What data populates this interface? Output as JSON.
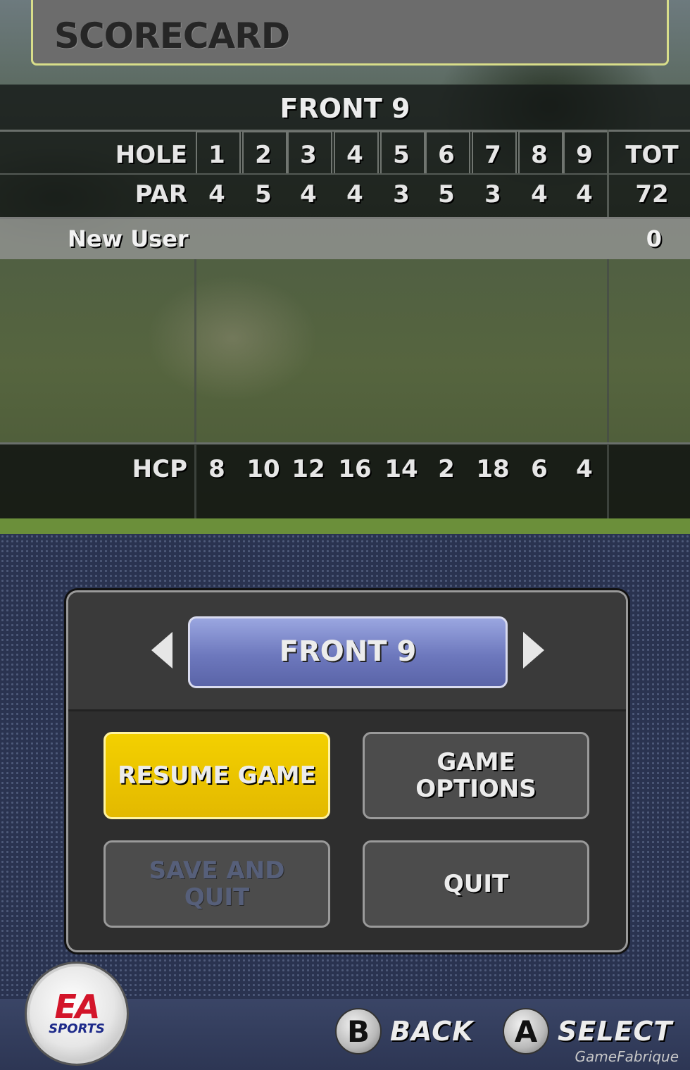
{
  "title": "SCORECARD",
  "section_title": "FRONT 9",
  "scorecard": {
    "hole_label": "HOLE",
    "par_label": "PAR",
    "hcp_label": "HCP",
    "tot_label": "TOT",
    "holes": [
      "1",
      "2",
      "3",
      "4",
      "5",
      "6",
      "7",
      "8",
      "9"
    ],
    "par": [
      "4",
      "5",
      "4",
      "4",
      "3",
      "5",
      "3",
      "4",
      "4"
    ],
    "par_total": "72",
    "hcp": [
      "8",
      "10",
      "12",
      "16",
      "14",
      "2",
      "18",
      "6",
      "4"
    ],
    "player": {
      "name": "New User",
      "total": "0"
    }
  },
  "selector": {
    "value": "FRONT 9"
  },
  "menu": {
    "resume": "RESUME GAME",
    "options": "GAME\nOPTIONS",
    "save_quit": "SAVE AND\nQUIT",
    "quit": "QUIT"
  },
  "controls": {
    "back_key": "B",
    "back_label": "BACK",
    "select_key": "A",
    "select_label": "SELECT"
  },
  "logo": {
    "main": "EA",
    "sub": "SPORTS"
  },
  "watermark": "GameFabrique",
  "colors": {
    "highlight": "#e8c300",
    "selector": "#7a85c8",
    "panel": "#2e2e2e"
  }
}
